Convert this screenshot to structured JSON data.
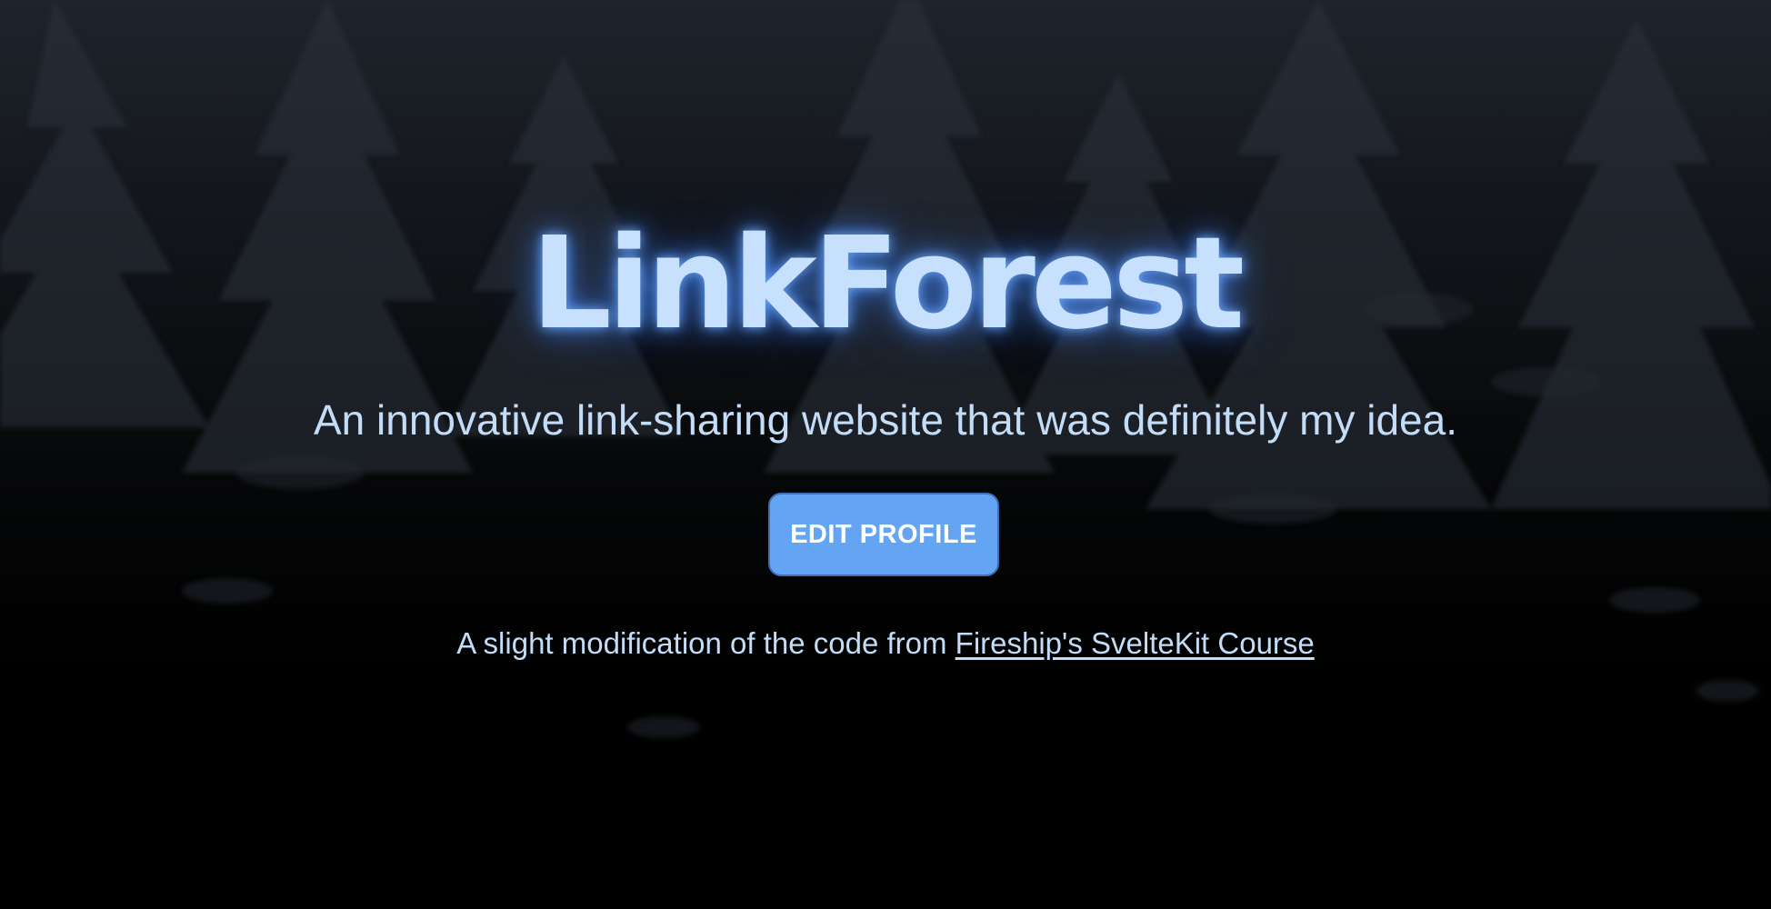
{
  "hero": {
    "title": "LinkForest",
    "subtitle": "An innovative link-sharing website that was definitely my idea.",
    "edit_button_label": "EDIT PROFILE"
  },
  "footer": {
    "credit_prefix": "A slight modification of the code from ",
    "credit_link_text": "Fireship's SvelteKit Course"
  },
  "colors": {
    "title": "#c6e0fd",
    "text": "#c3dcf7",
    "button": "#64a5f3",
    "background_top": "#1f242c",
    "background_bottom": "#000000"
  }
}
